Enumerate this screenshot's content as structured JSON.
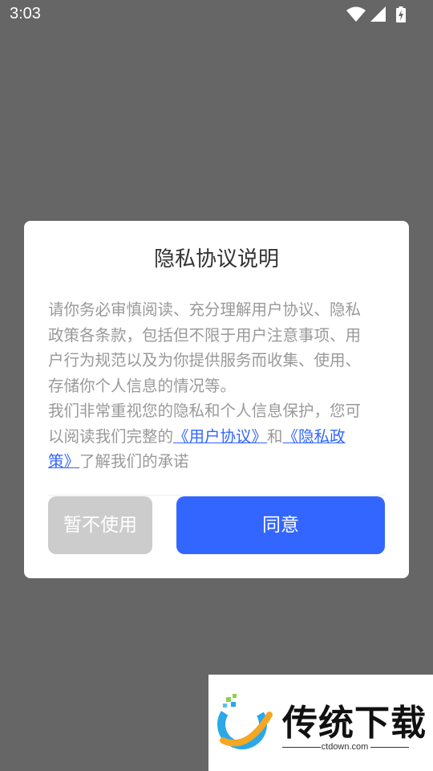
{
  "status_bar": {
    "time": "3:03",
    "icons": [
      "wifi-icon",
      "signal-icon",
      "battery-charging-icon"
    ]
  },
  "dialog": {
    "title": "隐私协议说明",
    "body_lines": [
      "请你务必审慎阅读、充分理解用户协议、隐私",
      "政策各条款，包括但不限于用户注意事项、用",
      "户行为规范以及为你提供服务而收集、使用、",
      "存储你个人信息的情况等。",
      "我们非常重视您的隐私和个人信息保护，您可"
    ],
    "line6_prefix": "以阅读我们完整的",
    "user_agreement_link_text": "《用户协议》",
    "and_text": "和",
    "privacy_link_part1": "《隐私政",
    "privacy_link_part2": "策》",
    "suffix_text": "了解我们的承诺",
    "decline_label": "暂不使用",
    "agree_label": "同意",
    "colors": {
      "primary": "#3366ff",
      "decline_bg": "#cccccc",
      "body_text": "#999999",
      "title_text": "#333333",
      "overlay": "#666666"
    }
  },
  "watermark": {
    "title": "传统下载",
    "domain": "ctdown.com"
  }
}
